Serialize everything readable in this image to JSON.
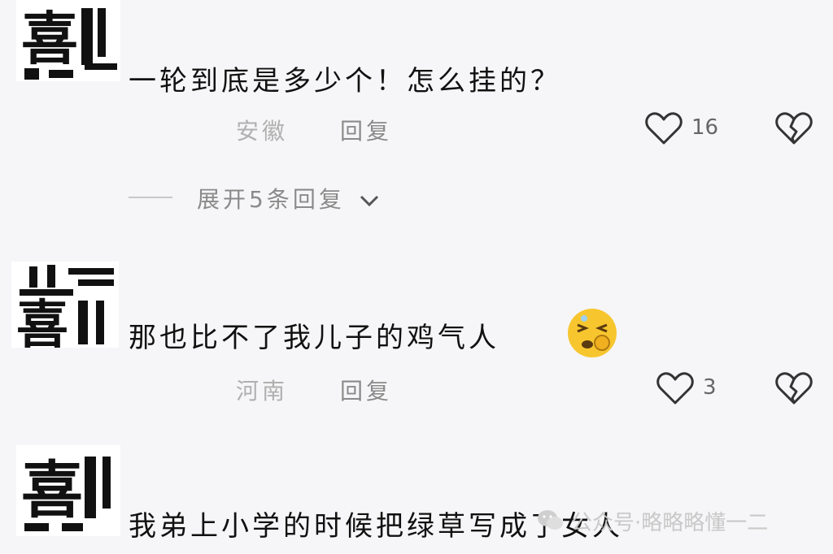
{
  "comments": [
    {
      "text": "一轮到底是多少个！怎么挂的？",
      "location": "安徽",
      "reply_label": "回复",
      "likes": "16",
      "expand_label": "展开5条回复",
      "avatar_chars": "喜"
    },
    {
      "text": "那也比不了我儿子的鸡气人",
      "location": "河南",
      "reply_label": "回复",
      "likes": "3",
      "emoji": "face-with-symbols-emoji",
      "avatar_chars": "喜"
    },
    {
      "text": "我弟上小学的时候把绿草写成了女人",
      "avatar_chars": "喜"
    }
  ],
  "icons": {
    "like": "heart-outline-icon",
    "dislike": "broken-heart-icon",
    "expand": "chevron-down-icon",
    "watermark": "wechat-icon"
  },
  "watermark": {
    "text": "公众号·略略略懂一二"
  },
  "colors": {
    "background": "#f6f6f8",
    "text": "#111111",
    "meta": "#b0b0b0",
    "emoji": "#f7c62f"
  }
}
